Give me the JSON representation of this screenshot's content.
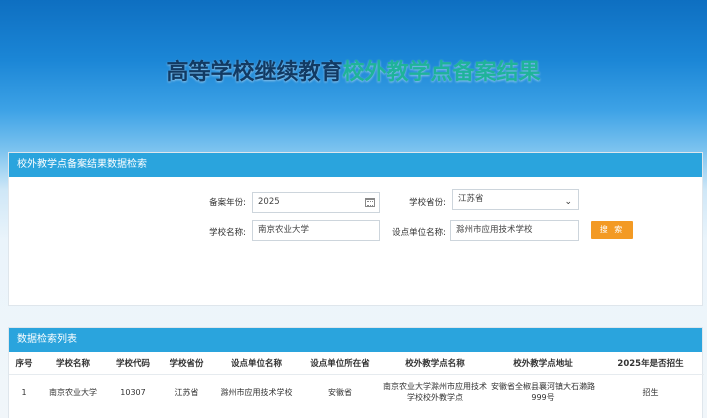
{
  "banner": {
    "title_part1": "高等学校继续教育",
    "title_part2": "校外教学点备案结果"
  },
  "search": {
    "header": "校外教学点备案结果数据检索",
    "year_label": "备案年份:",
    "year_value": "2025",
    "province_label": "学校省份:",
    "province_value": "江苏省",
    "school_label": "学校名称:",
    "school_value": "南京农业大学",
    "unit_label": "设点单位名称:",
    "unit_value": "滁州市应用技术学校",
    "search_button": "搜 索"
  },
  "list": {
    "header": "数据检索列表",
    "columns": [
      "序号",
      "学校名称",
      "学校代码",
      "学校省份",
      "设点单位名称",
      "设点单位所在省",
      "校外教学点名称",
      "校外教学点地址",
      "2025年是否招生"
    ],
    "rows": [
      [
        "1",
        "南京农业大学",
        "10307",
        "江苏省",
        "滁州市应用技术学校",
        "安徽省",
        "南京农业大学滁州市应用技术学校校外教学点",
        "安徽省全椒县襄河镇大石濑路999号",
        "招生"
      ]
    ]
  },
  "colors": {
    "header_blue": "#2aa4dd",
    "title_dark": "#123a63",
    "title_green": "#1fb39a",
    "button_orange": "#f39a24"
  }
}
